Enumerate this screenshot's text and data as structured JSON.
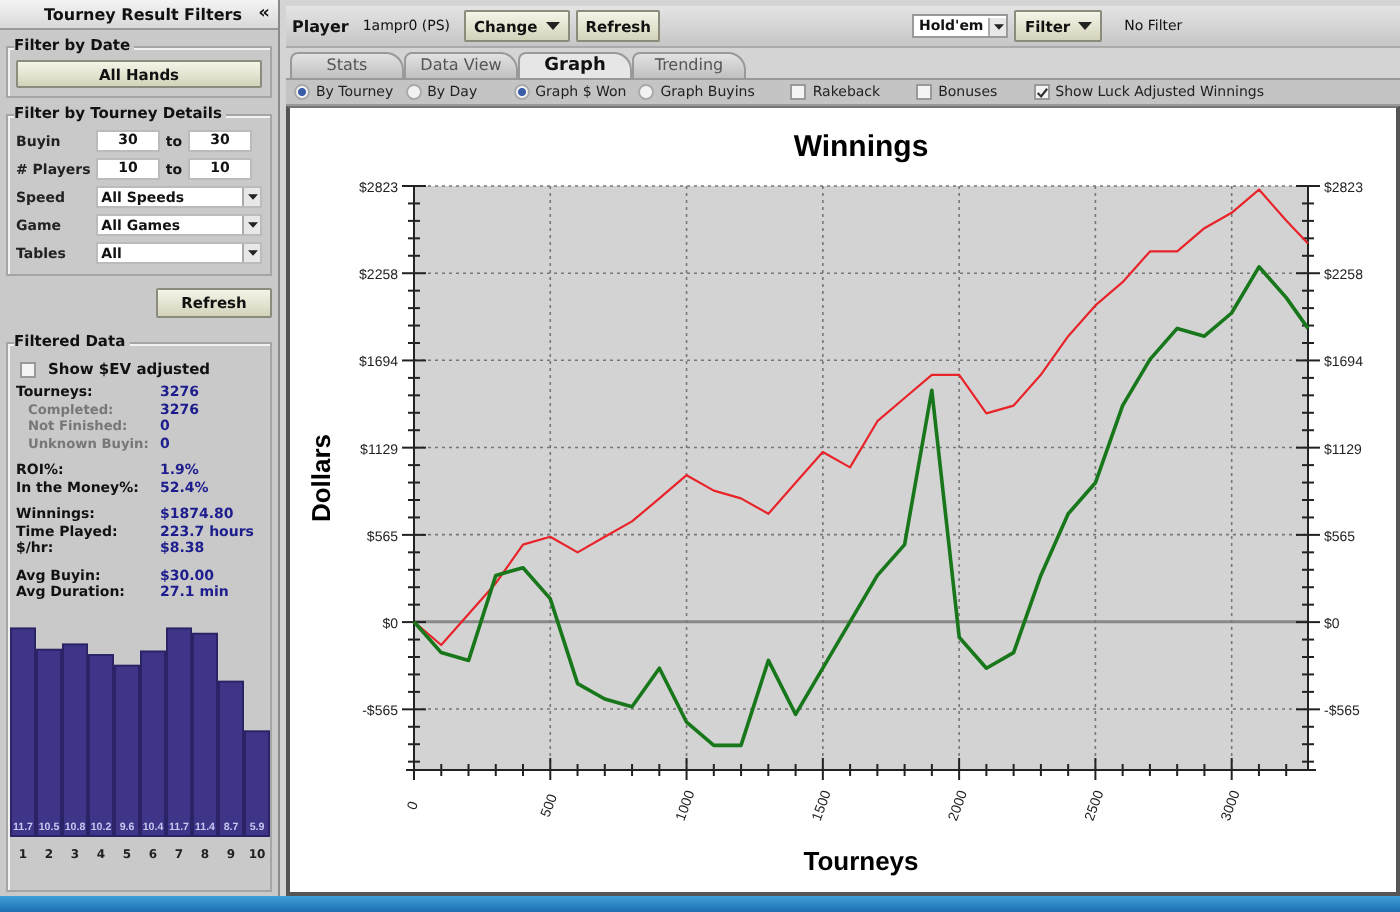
{
  "filters_panel": {
    "title": "Tourney Result Filters",
    "collapse": "«",
    "date_group": {
      "title": "Filter by Date",
      "button": "All Hands"
    },
    "details_group": {
      "title": "Filter by Tourney Details",
      "ranges": [
        {
          "label": "Buyin",
          "from": "30",
          "to_label": "to",
          "to": "30"
        },
        {
          "label": "# Players",
          "from": "10",
          "to_label": "to",
          "to": "10"
        }
      ],
      "selects": [
        {
          "label": "Speed",
          "value": "All Speeds"
        },
        {
          "label": "Game",
          "value": "All Games"
        },
        {
          "label": "Tables",
          "value": "All"
        }
      ]
    },
    "refresh_button": "Refresh",
    "filtered_data": {
      "title": "Filtered Data",
      "ev_checkbox": {
        "label": "Show $EV adjusted",
        "checked": false
      },
      "stat_groups": [
        [
          {
            "label": "Tourneys:",
            "value": "3276",
            "sub": false
          },
          {
            "label": "Completed:",
            "value": "3276",
            "sub": true
          },
          {
            "label": "Not Finished:",
            "value": "0",
            "sub": true
          },
          {
            "label": "Unknown Buyin:",
            "value": "0",
            "sub": true
          }
        ],
        [
          {
            "label": "ROI%:",
            "value": "1.9%",
            "sub": false
          },
          {
            "label": "In the Money%:",
            "value": "52.4%",
            "sub": false
          }
        ],
        [
          {
            "label": "Winnings:",
            "value": "$1874.80",
            "sub": false
          },
          {
            "label": "Time Played:",
            "value": "223.7 hours",
            "sub": false
          },
          {
            "label": "$/hr:",
            "value": "$8.38",
            "sub": false
          }
        ],
        [
          {
            "label": "Avg Buyin:",
            "value": "$30.00",
            "sub": false
          },
          {
            "label": "Avg Duration:",
            "value": "27.1 min",
            "sub": false
          }
        ]
      ],
      "chart_data": {
        "type": "bar",
        "categories": [
          "1",
          "2",
          "3",
          "4",
          "5",
          "6",
          "7",
          "8",
          "9",
          "10"
        ],
        "values": [
          11.7,
          10.5,
          10.8,
          10.2,
          9.6,
          10.4,
          11.7,
          11.4,
          8.7,
          5.9
        ],
        "value_labels": [
          "11.7",
          "10.5",
          "10.8",
          "10.2",
          "9.6",
          "10.4",
          "11.7",
          "11.4",
          "8.7",
          "5.9"
        ]
      }
    }
  },
  "toolbar": {
    "player_label": "Player",
    "player": "1ampr0 (PS)",
    "buttons": [
      {
        "label": "Change",
        "dropdown": true
      },
      {
        "label": "Refresh",
        "dropdown": false
      }
    ],
    "game_select": "Hold'em",
    "filter_button": {
      "label": "Filter",
      "dropdown": true
    },
    "filter_status": "No Filter"
  },
  "tabs": [
    {
      "label": "Stats",
      "selected": false
    },
    {
      "label": "Data View",
      "selected": false
    },
    {
      "label": "Graph",
      "selected": true
    },
    {
      "label": "Trending",
      "selected": false
    }
  ],
  "option_groups": [
    [
      {
        "kind": "radio",
        "label": "By Tourney",
        "selected": true
      },
      {
        "kind": "radio",
        "label": "By Day",
        "selected": false
      }
    ],
    [
      {
        "kind": "radio",
        "label": "Graph $ Won",
        "selected": true
      },
      {
        "kind": "radio",
        "label": "Graph Buyins",
        "selected": false
      }
    ],
    [
      {
        "kind": "checkbox",
        "label": "Rakeback",
        "checked": false
      }
    ],
    [
      {
        "kind": "checkbox",
        "label": "Bonuses",
        "checked": false
      }
    ],
    [
      {
        "kind": "checkbox",
        "label": "Show Luck Adjusted Winnings",
        "checked": true
      }
    ]
  ],
  "graph": {
    "chart_data": {
      "type": "line",
      "title": "Winnings",
      "xlabel": "Tourneys",
      "ylabel": "Dollars",
      "x": [
        0,
        100,
        200,
        300,
        400,
        500,
        600,
        700,
        800,
        900,
        1000,
        1100,
        1200,
        1300,
        1400,
        1500,
        1600,
        1700,
        1800,
        1900,
        2000,
        2100,
        2200,
        2300,
        2400,
        2500,
        2600,
        2700,
        2800,
        2900,
        3000,
        3100,
        3200,
        3280
      ],
      "series": [
        {
          "color": "#e8242a",
          "values": [
            0,
            -150,
            50,
            250,
            500,
            550,
            450,
            550,
            650,
            800,
            950,
            850,
            800,
            700,
            900,
            1100,
            1000,
            1300,
            1450,
            1600,
            1600,
            1350,
            1400,
            1600,
            1850,
            2050,
            2200,
            2400,
            2400,
            2550,
            2650,
            2800,
            2600,
            2450
          ]
        },
        {
          "color": "#17771a",
          "values": [
            0,
            -200,
            -250,
            300,
            350,
            150,
            -400,
            -500,
            -550,
            -300,
            -650,
            -800,
            -800,
            -250,
            -600,
            -300,
            0,
            300,
            500,
            1500,
            -100,
            -300,
            -200,
            300,
            700,
            900,
            1400,
            1700,
            1900,
            1850,
            2000,
            2300,
            2100,
            1900
          ]
        }
      ],
      "xlim": [
        0,
        3280
      ],
      "ylim": [
        -960,
        2823
      ],
      "grid": true,
      "xticks": [
        {
          "value": 0,
          "label": "0"
        },
        {
          "value": 500,
          "label": "500"
        },
        {
          "value": 1000,
          "label": "1000"
        },
        {
          "value": 1500,
          "label": "1500"
        },
        {
          "value": 2000,
          "label": "2000"
        },
        {
          "value": 2500,
          "label": "2500"
        },
        {
          "value": 3000,
          "label": "3000"
        }
      ],
      "yticks": [
        {
          "value": 2823,
          "label": "$2823"
        },
        {
          "value": 2258,
          "label": "$2258"
        },
        {
          "value": 1694,
          "label": "$1694"
        },
        {
          "value": 1129,
          "label": "$1129"
        },
        {
          "value": 565,
          "label": "$565"
        },
        {
          "value": 0,
          "label": "$0"
        },
        {
          "value": -565,
          "label": "-$565"
        }
      ]
    },
    "right_axis_labels": [
      "$2823",
      "$2258",
      "$1694",
      "$1129",
      "$565",
      "$0",
      "-$565"
    ]
  }
}
